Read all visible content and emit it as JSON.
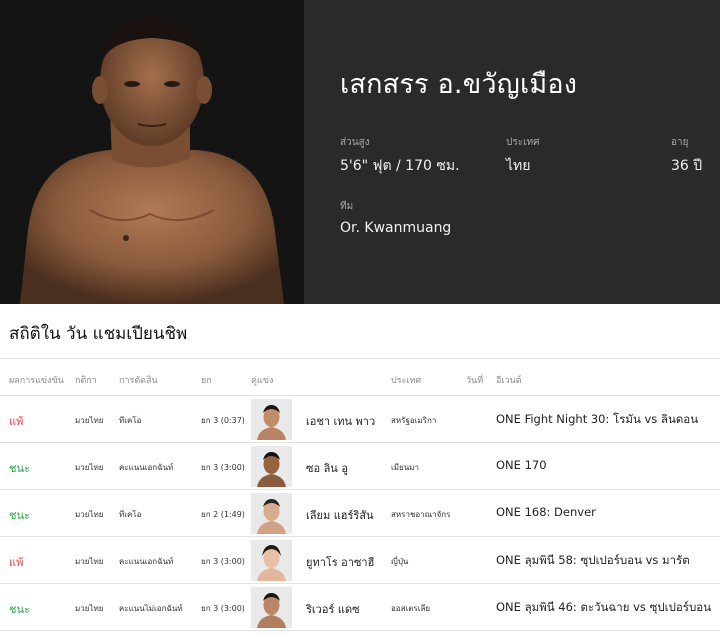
{
  "athlete": {
    "name": "เสกสรร อ.ขวัญเมือง",
    "height_label": "ส่วนสูง",
    "height_value": "5'6\" ฟุต / 170 ซม.",
    "country_label": "ประเทศ",
    "country_value": "ไทย",
    "age_label": "อายุ",
    "age_value": "36 ปี",
    "team_label": "ทีม",
    "team_value": "Or. Kwanmuang"
  },
  "record": {
    "title": "สถิติใน วัน แชมเปียนชิพ",
    "columns": {
      "result": "ผลการแข่งขัน",
      "sport": "กติกา",
      "method": "การตัดสิน",
      "round": "ยก",
      "opponent": "คู่แข่ง",
      "country": "ประเทศ",
      "date": "วันที่",
      "event": "อีเวนต์"
    },
    "rows": [
      {
        "result": "แพ้",
        "sport": "มวยไทย",
        "method": "ทีเคโอ",
        "round": "ยก 3 (0:37)",
        "opponent": "เอชา เทน พาว",
        "country": "สหรัฐอเมริกา",
        "event": "ONE Fight Night 30: โรมัน vs ลินดอน"
      },
      {
        "result": "ชนะ",
        "sport": "มวยไทย",
        "method": "คะแนนเอกฉันท์",
        "round": "ยก 3 (3:00)",
        "opponent": "ซอ ลิน อู",
        "country": "เมียนมา",
        "event": "ONE 170"
      },
      {
        "result": "ชนะ",
        "sport": "มวยไทย",
        "method": "ทีเคโอ",
        "round": "ยก 2 (1:49)",
        "opponent": "เลียม แฮร์ริสัน",
        "country": "สหราชอาณาจักร",
        "event": "ONE 168: Denver"
      },
      {
        "result": "แพ้",
        "sport": "มวยไทย",
        "method": "คะแนนเอกฉันท์",
        "round": "ยก 3 (3:00)",
        "opponent": "ยูทาโร อาซาฮี",
        "country": "ญี่ปุ่น",
        "event": "ONE ลุมพินี 58: ซุปเปอร์บอน vs มารัต"
      },
      {
        "result": "ชนะ",
        "sport": "มวยไทย",
        "method": "คะแนนไม่เอกฉันท์",
        "round": "ยก 3 (3:00)",
        "opponent": "ริเวอร์ แดซ",
        "country": "ออสเตรเลีย",
        "event": "ONE ลุมพินี 46: ตะวันฉาย vs ซุปเปอร์บอน"
      }
    ]
  },
  "colors": {
    "loss": "#e0463e",
    "win": "#27a447",
    "hero_info_bg": "#2a2a2a",
    "hero_photo_bg": "#141414"
  }
}
